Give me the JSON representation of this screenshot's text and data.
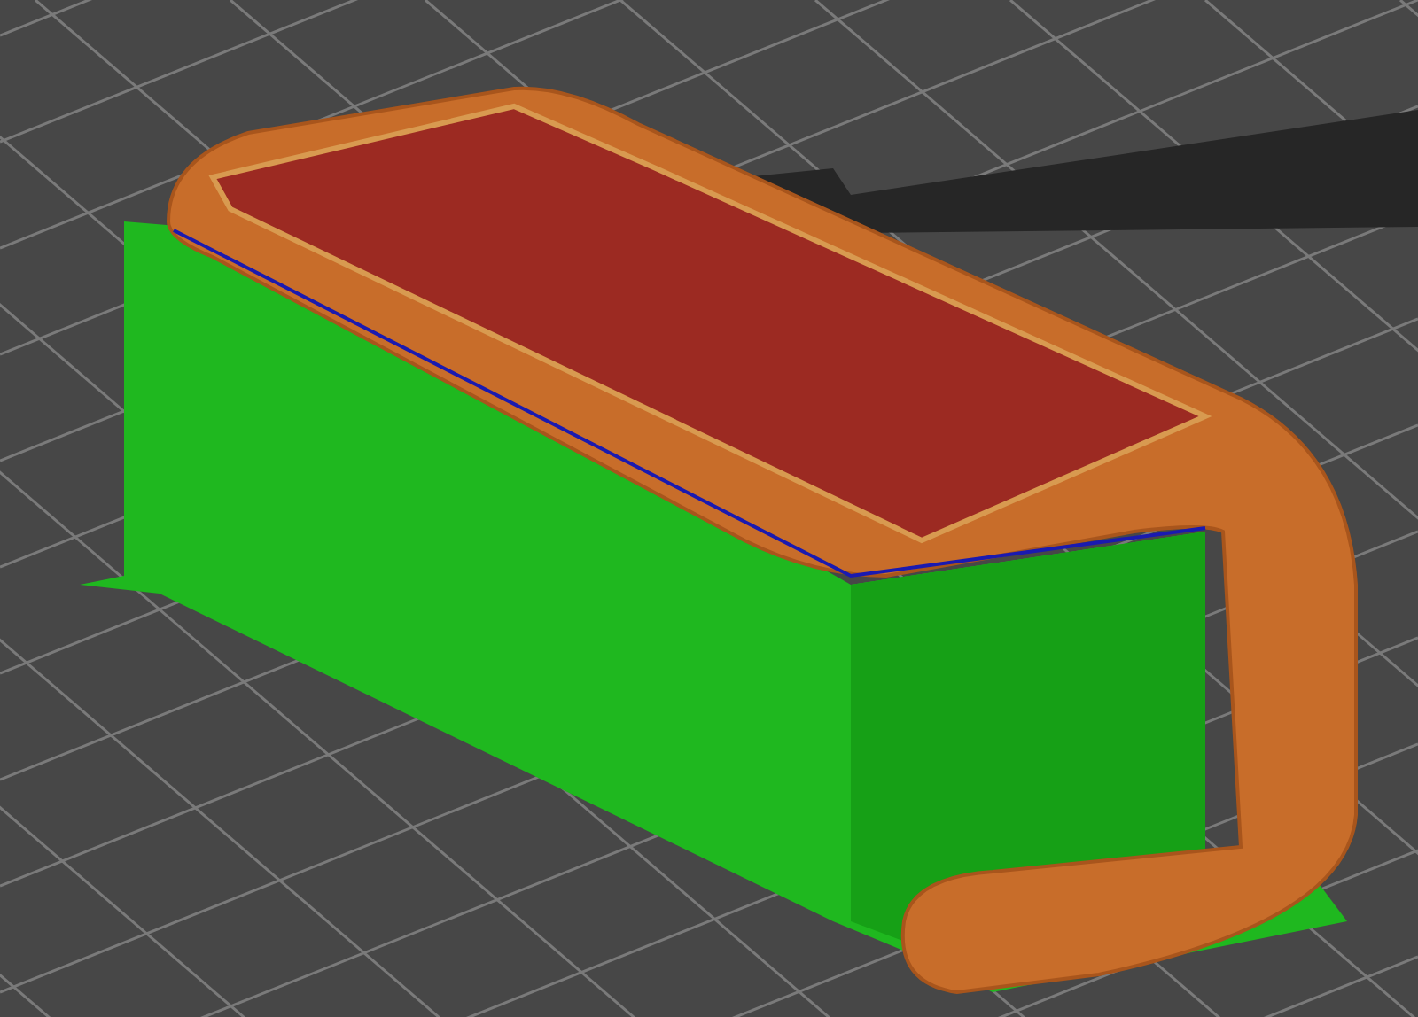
{
  "viewport": {
    "kind": "toolpath-preview"
  }
}
